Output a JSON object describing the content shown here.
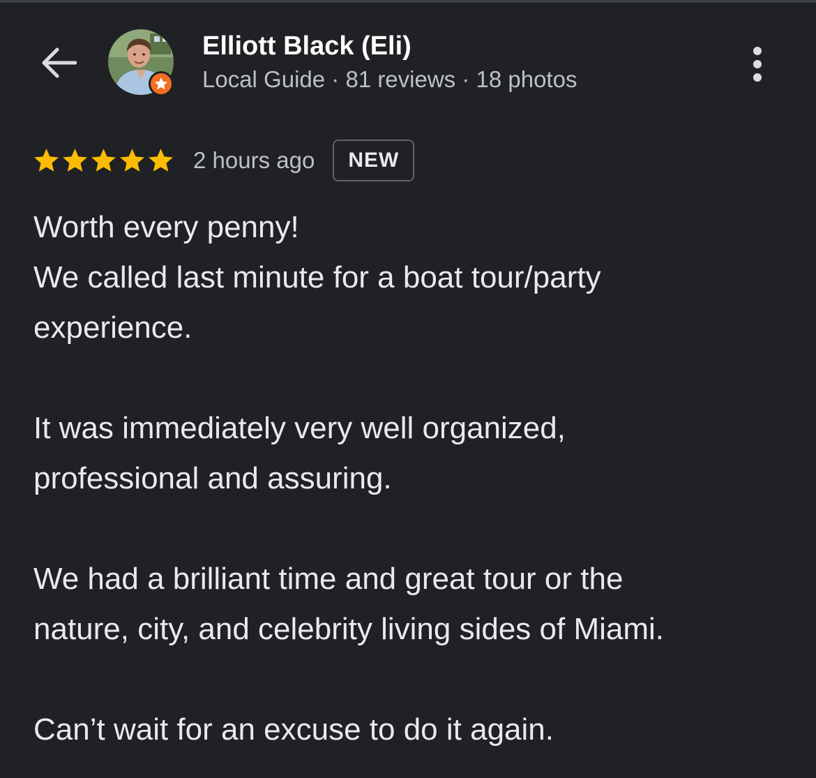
{
  "header": {
    "back_icon": "arrow-left-icon",
    "author_name": "Elliott Black (Eli)",
    "author_meta": "Local Guide · 81 reviews · 18 photos",
    "more_icon": "more-vertical-icon",
    "badge_icon": "local-guide-star-icon",
    "badge_color": "#f26e22"
  },
  "rating": {
    "stars": 5,
    "max_stars": 5,
    "star_color": "#fbbc04",
    "time": "2 hours ago",
    "badge": "NEW"
  },
  "review": {
    "lines": [
      "Worth every penny!",
      "We called last minute for a boat tour/party",
      "experience.",
      "",
      "It was immediately very well organized,",
      "professional and assuring.",
      "",
      "We had a brilliant time and great tour or the",
      "nature, city, and celebrity living sides of Miami.",
      "",
      "Can’t wait for an excuse to do it again."
    ]
  },
  "colors": {
    "background": "#202124",
    "text_primary": "#ffffff",
    "text_secondary": "#bdc1c6"
  }
}
